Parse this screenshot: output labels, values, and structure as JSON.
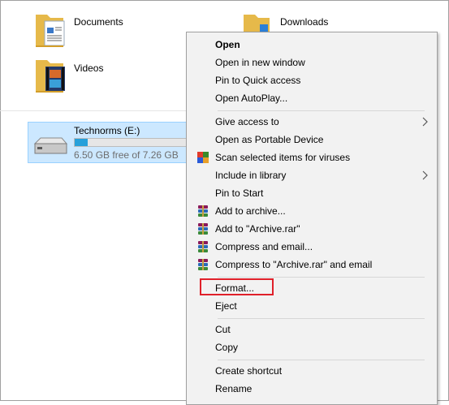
{
  "folders": [
    {
      "name": "Documents"
    },
    {
      "name": "Downloads"
    },
    {
      "name": "Videos"
    }
  ],
  "drive": {
    "name": "Technorms (E:)",
    "free_text": "6.50 GB free of 7.26 GB",
    "used_fraction": 0.105
  },
  "menu": {
    "items": [
      {
        "label": "Open",
        "bold": true
      },
      {
        "label": "Open in new window"
      },
      {
        "label": "Pin to Quick access"
      },
      {
        "label": "Open AutoPlay..."
      },
      {
        "label": "Give access to",
        "submenu": true
      },
      {
        "label": "Open as Portable Device"
      },
      {
        "label": "Scan selected items for viruses",
        "icon": "antivirus-icon"
      },
      {
        "label": "Include in library",
        "submenu": true
      },
      {
        "label": "Pin to Start"
      },
      {
        "label": "Add to archive...",
        "icon": "winrar-icon"
      },
      {
        "label": "Add to \"Archive.rar\"",
        "icon": "winrar-icon"
      },
      {
        "label": "Compress and email...",
        "icon": "winrar-icon"
      },
      {
        "label": "Compress to \"Archive.rar\" and email",
        "icon": "winrar-icon"
      },
      {
        "label": "Format..."
      },
      {
        "label": "Eject"
      },
      {
        "label": "Cut"
      },
      {
        "label": "Copy"
      },
      {
        "label": "Create shortcut"
      },
      {
        "label": "Rename"
      }
    ]
  },
  "colors": {
    "selection": "#cce8ff",
    "progress": "#26a0da",
    "highlight_box": "#e0202a"
  }
}
